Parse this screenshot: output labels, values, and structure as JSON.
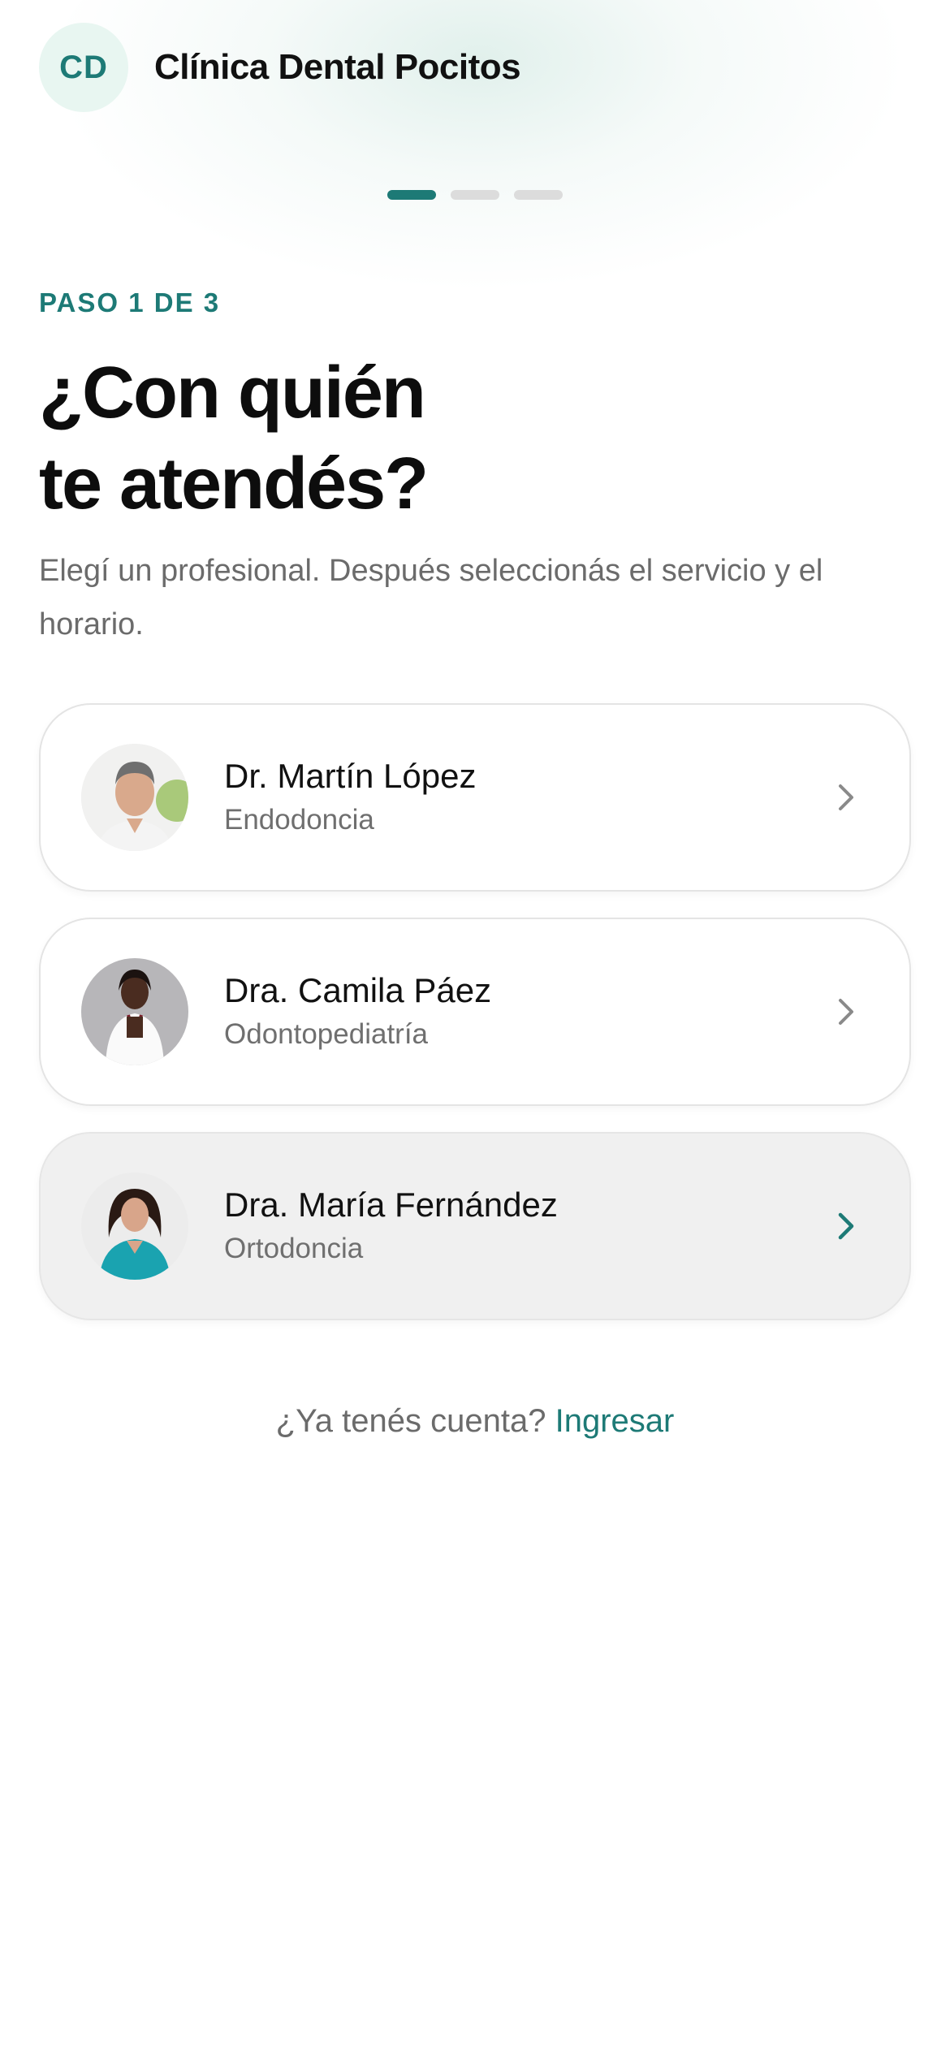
{
  "header": {
    "logo_initials": "CD",
    "clinic_name": "Clínica Dental Pocitos"
  },
  "progress": {
    "total_steps": 3,
    "current_step": 1
  },
  "step_label": "PASO 1 DE 3",
  "title_line1": "¿Con quién",
  "title_line2": "te atendés?",
  "subtitle": "Elegí un profesional. Después seleccionás el servicio y el horario.",
  "professionals": [
    {
      "name": "Dr. Martín López",
      "specialty": "Endodoncia",
      "selected": false,
      "avatar_icon": "doctor-photo-male"
    },
    {
      "name": "Dra. Camila Páez",
      "specialty": "Odontopediatría",
      "selected": false,
      "avatar_icon": "doctor-photo-female"
    },
    {
      "name": "Dra. María Fernández",
      "specialty": "Ortodoncia",
      "selected": true,
      "avatar_icon": "doctor-photo-female"
    }
  ],
  "login": {
    "prompt": "¿Ya tenés cuenta?",
    "link_label": "Ingresar"
  },
  "colors": {
    "accent": "#1d7a76",
    "logo_bg": "#e8f6f1",
    "muted_text": "#6b6b6b",
    "selected_card_bg": "#f0f0f0"
  }
}
